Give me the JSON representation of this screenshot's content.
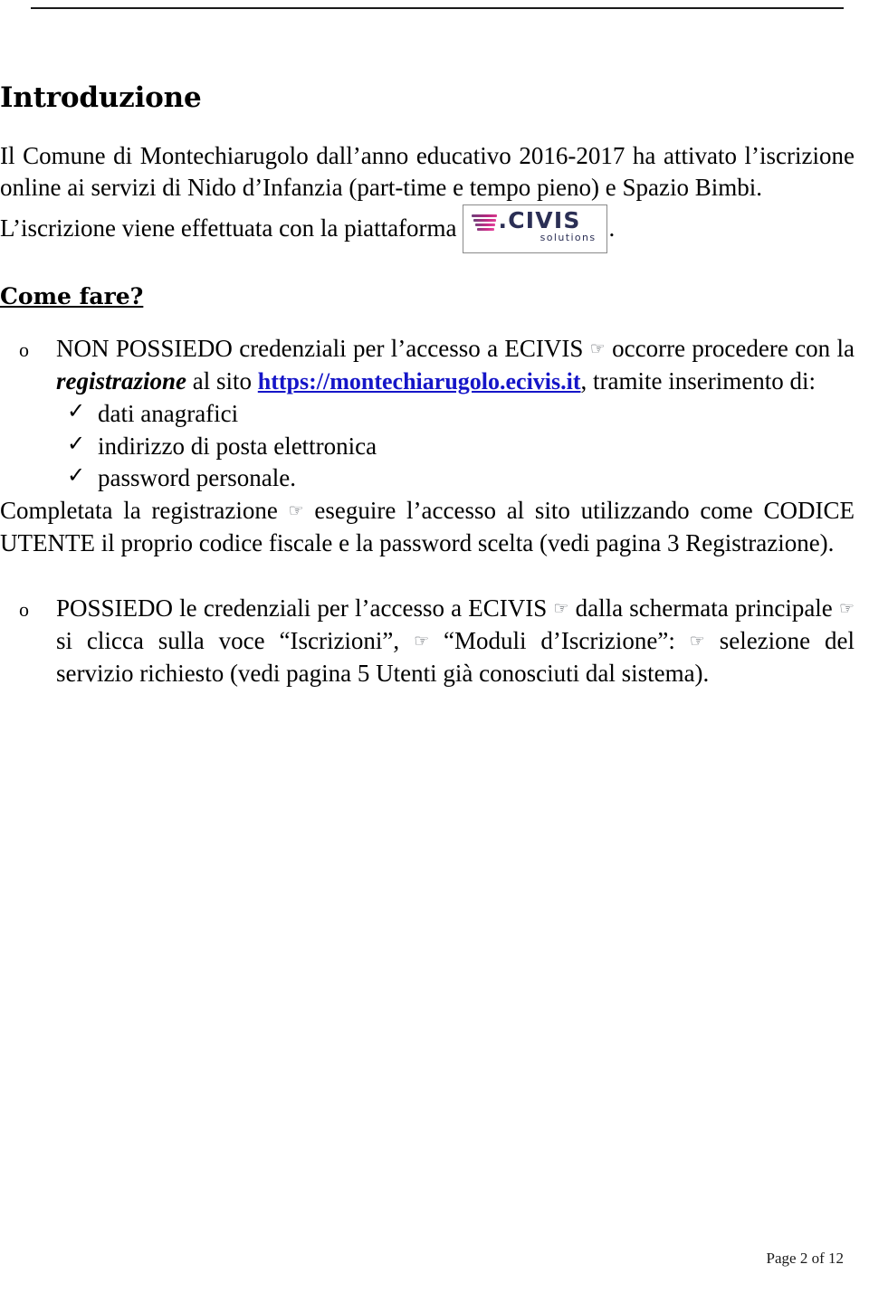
{
  "document": {
    "title": "Introduzione",
    "top_rule": true
  },
  "intro": {
    "paragraph": "Il Comune di Montechiarugolo dall’anno educativo 2016-2017 ha attivato l’iscrizione online ai servizi di Nido d’Infanzia (part-time e tempo pieno) e Spazio Bimbi."
  },
  "platform": {
    "lead": "L’iscrizione viene effettuata con la piattaforma",
    "trailing": ".",
    "logo": {
      "name": "CIVIS solutions",
      "wordmark": ".CIVIS",
      "tagline": "solutions"
    }
  },
  "section": {
    "heading": "Come fare?"
  },
  "option_no_credentials": {
    "marker": "o",
    "line1_a": "NON POSSIEDO credenziali per l’accesso a ECIVIS",
    "hand": "☞",
    "line1_b": "occorre procedere con la",
    "emphasis": "registrazione",
    "line2_b": "al sito",
    "url_text": "https://montechiarugolo.ecivis.it",
    "after_url": ",",
    "line3": "tramite inserimento di:",
    "checklist": [
      "dati anagrafici",
      "indirizzo di posta elettronica",
      "password personale."
    ],
    "followup_a": "Completata la registrazione",
    "followup_b": "eseguire l’accesso al sito utilizzando come",
    "codice_utente": "CODICE UTENTE",
    "followup_c": "il proprio codice fiscale e la password scelta (vedi pagina 3 Registrazione)."
  },
  "option_has_credentials": {
    "marker": "o",
    "part_a": "POSSIEDO le credenziali  per l’accesso a ECIVIS",
    "part_b": "dalla schermata principale",
    "part_c": "si clicca sulla voce “Iscrizioni”,",
    "part_d": "“Moduli d’Iscrizione”:",
    "part_e": "selezione del servizio richiesto (vedi pagina 5 Utenti già conosciuti dal sistema)."
  },
  "footer": {
    "page_label": "Page 2 of 12"
  },
  "colors": {
    "link": "#1515c8",
    "logo_navy": "#2b2f55",
    "logo_magenta": "#c22b83",
    "text": "#000000"
  }
}
